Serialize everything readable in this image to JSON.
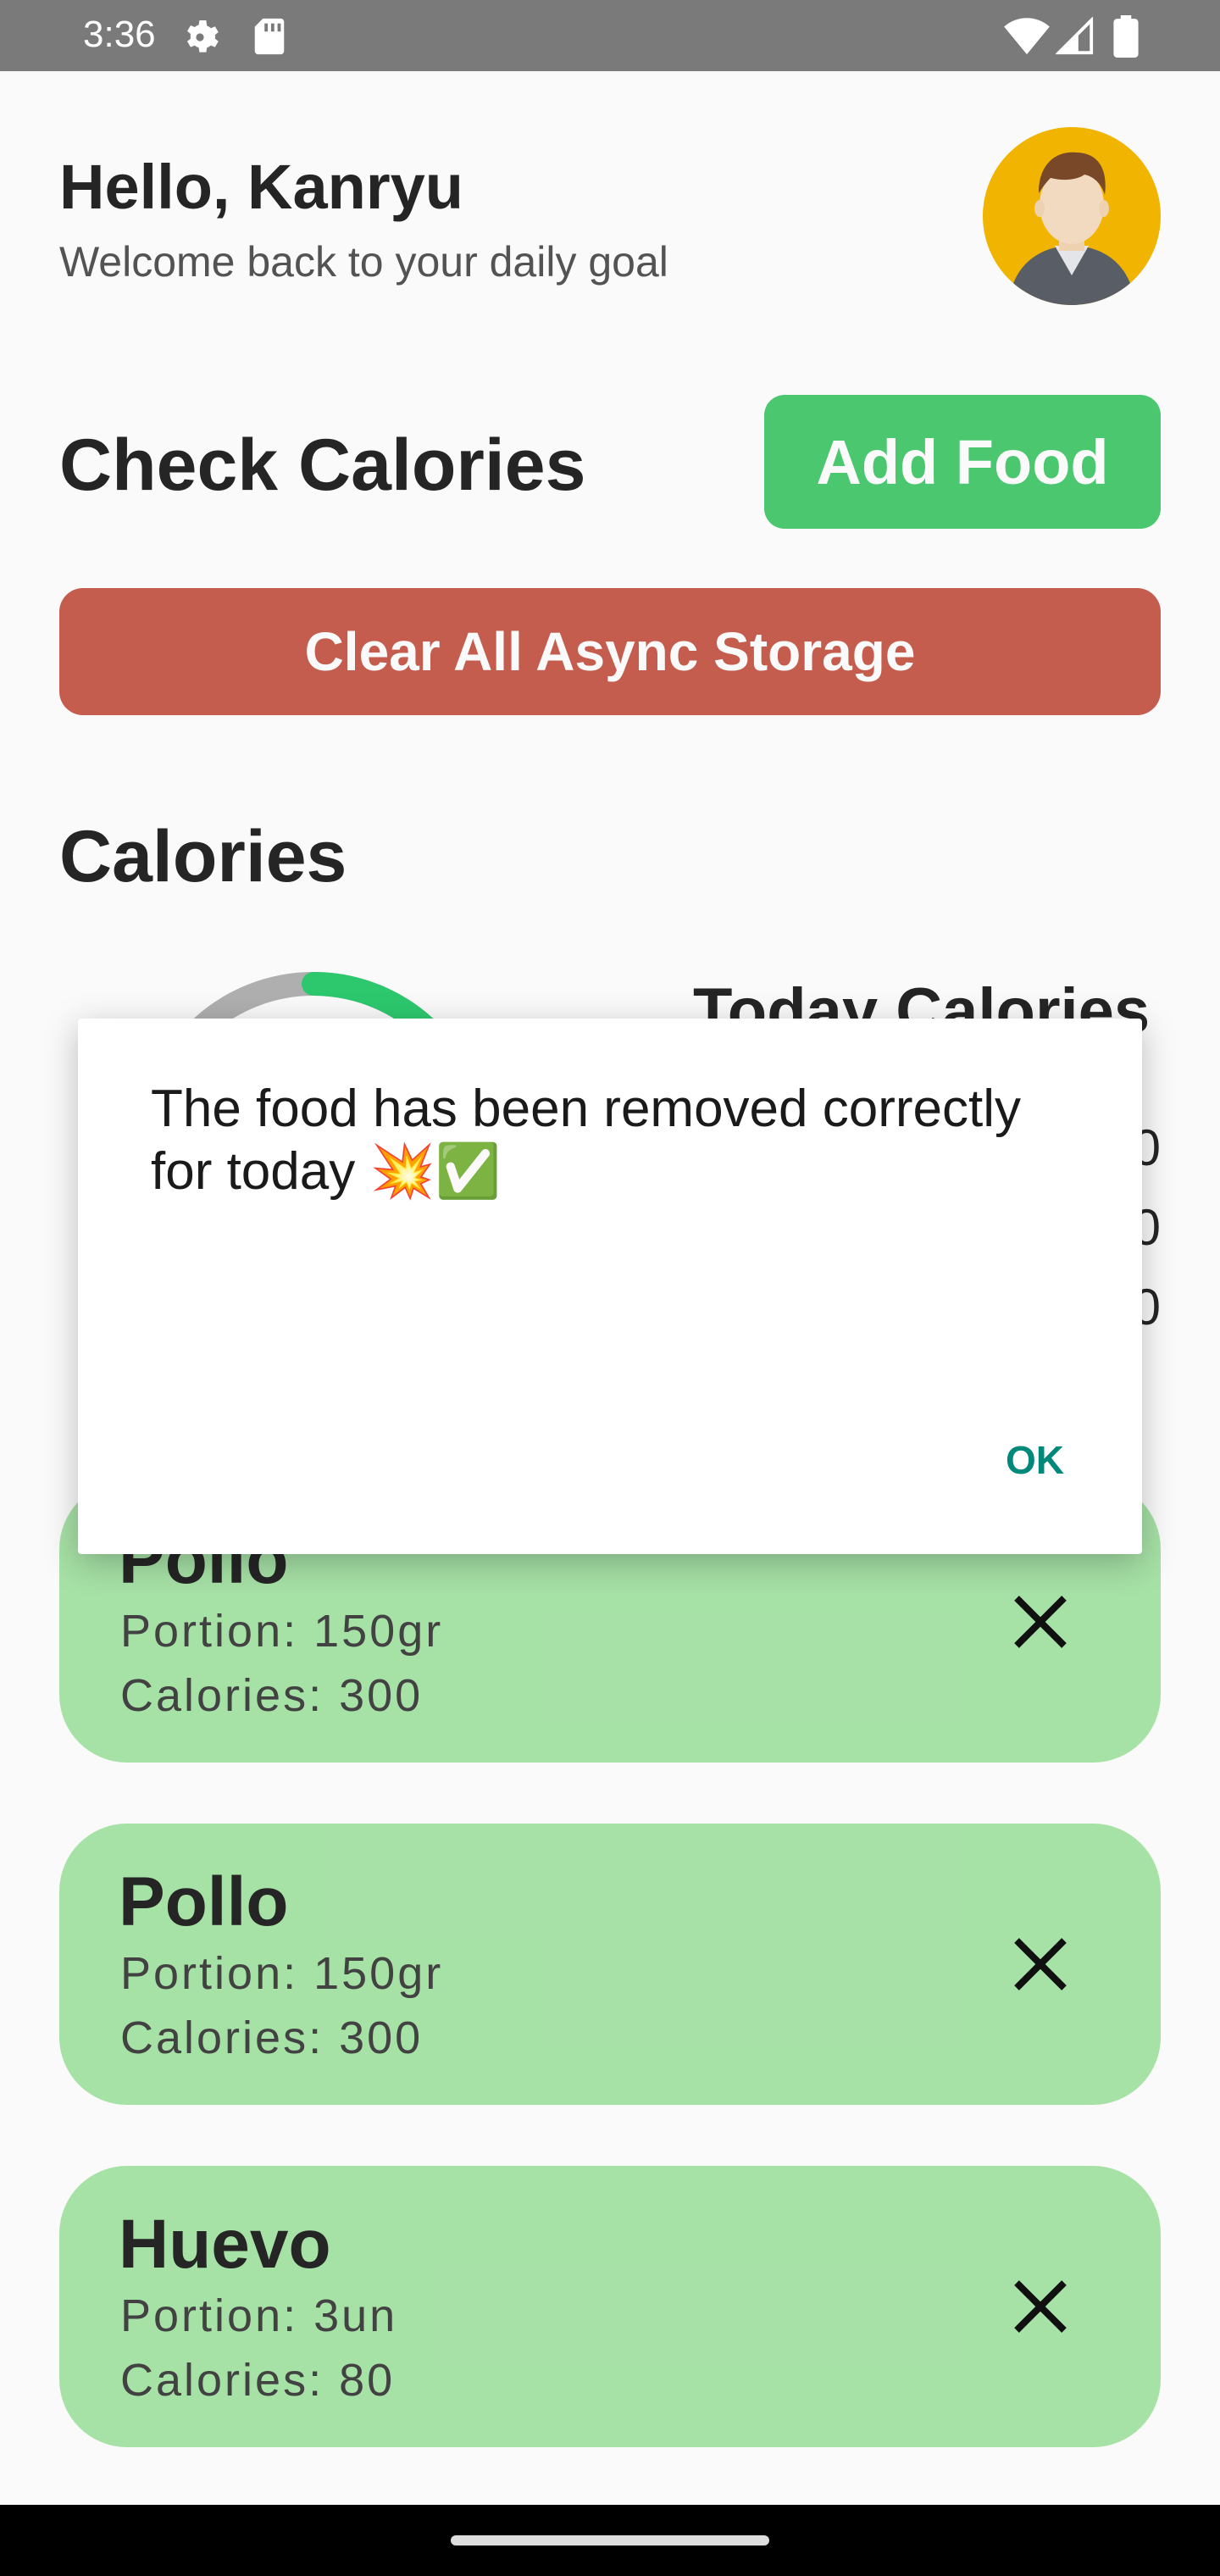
{
  "status_bar": {
    "time": "3:36",
    "icons": [
      "gear-icon",
      "sd-card-icon",
      "wifi-icon",
      "signal-icon",
      "battery-icon"
    ]
  },
  "header": {
    "greeting": "Hello, Kanryu",
    "subtitle": "Welcome back to your daily goal",
    "avatar_icon": "user-avatar-icon"
  },
  "check_calories": {
    "title": "Check Calories",
    "add_food_label": "Add Food"
  },
  "clear_storage_label": "Clear All Async Storage",
  "calories_section": {
    "title": "Calories",
    "today_title": "Today Calories",
    "values_partial": [
      "0",
      "0",
      "0"
    ],
    "ring_progress": 0.18
  },
  "foods": [
    {
      "name": "Pollo",
      "portion": "Portion: 150gr",
      "calories": "Calories: 300"
    },
    {
      "name": "Pollo",
      "portion": "Portion: 150gr",
      "calories": "Calories: 300"
    },
    {
      "name": "Huevo",
      "portion": "Portion: 3un",
      "calories": "Calories: 80"
    }
  ],
  "dialog": {
    "message": "The food has been removed correctly for today 💥✅",
    "ok_label": "OK"
  },
  "colors": {
    "add_food": "#4dcc72",
    "clear": "#c95f50",
    "food_card": "#aae6aa",
    "ok": "#00897b",
    "ring_progress": "#2ecc71",
    "ring_track": "#b3b3b3"
  }
}
